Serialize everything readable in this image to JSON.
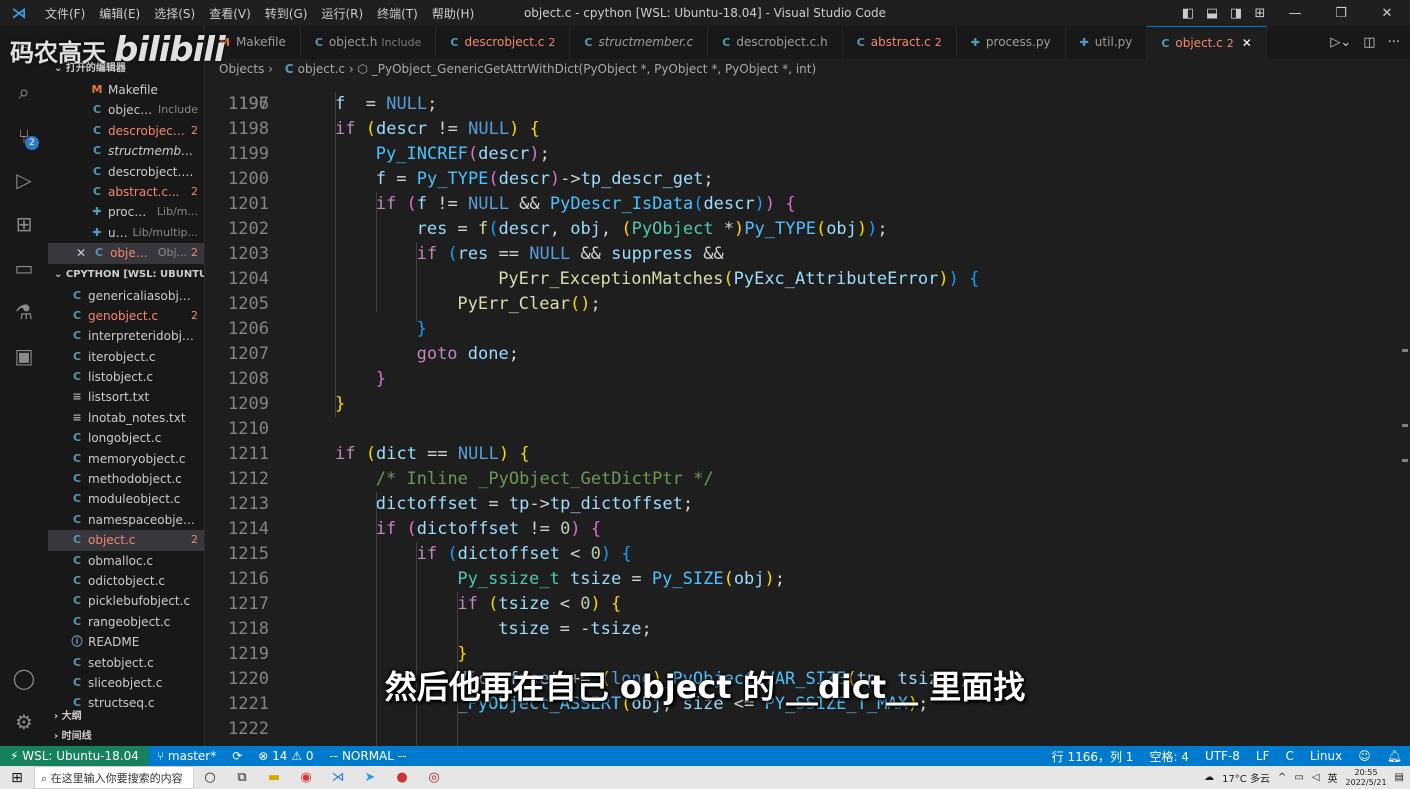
{
  "titlebar": {
    "menus": [
      "文件(F)",
      "编辑(E)",
      "选择(S)",
      "查看(V)",
      "转到(G)",
      "运行(R)",
      "终端(T)",
      "帮助(H)"
    ],
    "window_title": "object.c - cpython [WSL: Ubuntu-18.04] - Visual Studio Code"
  },
  "watermark": {
    "text": "码农高天",
    "brand": "bilibili"
  },
  "activity": {
    "scm_badge": "2"
  },
  "sidebar": {
    "open_editors_header": "打开的编辑器",
    "open_editors": [
      {
        "icon": "M",
        "name": "Makefile",
        "hint": "",
        "badge": "",
        "kind": "m"
      },
      {
        "icon": "C",
        "name": "object.h",
        "hint": "Include",
        "badge": "",
        "kind": "c"
      },
      {
        "icon": "C",
        "name": "descrobject....",
        "hint": "",
        "badge": "2",
        "kind": "c",
        "error": true
      },
      {
        "icon": "C",
        "name": "structmember.c...",
        "hint": "",
        "badge": "",
        "kind": "c",
        "italic": true
      },
      {
        "icon": "C",
        "name": "descrobject.c.h...",
        "hint": "",
        "badge": "",
        "kind": "c"
      },
      {
        "icon": "C",
        "name": "abstract.c...",
        "hint": "",
        "badge": "2",
        "kind": "c",
        "error": true
      },
      {
        "icon": "✚",
        "name": "process.py",
        "hint": "Lib/m...",
        "badge": "",
        "kind": "py"
      },
      {
        "icon": "✚",
        "name": "util.py",
        "hint": "Lib/multip...",
        "badge": "",
        "kind": "py"
      },
      {
        "icon": "C",
        "name": "object.c",
        "hint": "Obj...",
        "badge": "2",
        "kind": "c",
        "error": true,
        "active": true
      }
    ],
    "workspace_header": "CPYTHON [WSL: UBUNTU-...",
    "files": [
      {
        "icon": "C",
        "name": "genericaliasobject.c",
        "kind": "c",
        "badge": ""
      },
      {
        "icon": "C",
        "name": "genobject.c",
        "kind": "c",
        "badge": "2",
        "error": true
      },
      {
        "icon": "C",
        "name": "interpreteridobject.c",
        "kind": "c",
        "badge": ""
      },
      {
        "icon": "C",
        "name": "iterobject.c",
        "kind": "c",
        "badge": ""
      },
      {
        "icon": "C",
        "name": "listobject.c",
        "kind": "c",
        "badge": ""
      },
      {
        "icon": "≡",
        "name": "listsort.txt",
        "kind": "txt",
        "badge": ""
      },
      {
        "icon": "≡",
        "name": "lnotab_notes.txt",
        "kind": "txt",
        "badge": ""
      },
      {
        "icon": "C",
        "name": "longobject.c",
        "kind": "c",
        "badge": ""
      },
      {
        "icon": "C",
        "name": "memoryobject.c",
        "kind": "c",
        "badge": ""
      },
      {
        "icon": "C",
        "name": "methodobject.c",
        "kind": "c",
        "badge": ""
      },
      {
        "icon": "C",
        "name": "moduleobject.c",
        "kind": "c",
        "badge": ""
      },
      {
        "icon": "C",
        "name": "namespaceobject.c",
        "kind": "c",
        "badge": ""
      },
      {
        "icon": "C",
        "name": "object.c",
        "kind": "c",
        "badge": "2",
        "error": true,
        "active": true
      },
      {
        "icon": "C",
        "name": "obmalloc.c",
        "kind": "c",
        "badge": ""
      },
      {
        "icon": "C",
        "name": "odictobject.c",
        "kind": "c",
        "badge": ""
      },
      {
        "icon": "C",
        "name": "picklebufobject.c",
        "kind": "c",
        "badge": ""
      },
      {
        "icon": "C",
        "name": "rangeobject.c",
        "kind": "c",
        "badge": ""
      },
      {
        "icon": "ⓘ",
        "name": "README",
        "kind": "info",
        "badge": ""
      },
      {
        "icon": "C",
        "name": "setobject.c",
        "kind": "c",
        "badge": ""
      },
      {
        "icon": "C",
        "name": "sliceobject.c",
        "kind": "c",
        "badge": ""
      },
      {
        "icon": "C",
        "name": "structseq.c",
        "kind": "c",
        "badge": ""
      }
    ],
    "outline_label": "大纲",
    "timeline_label": "时间线"
  },
  "tabs": [
    {
      "icon": "M",
      "name": "Makefile",
      "hint": "",
      "badge": "",
      "kind": "m"
    },
    {
      "icon": "C",
      "name": "object.h",
      "hint": "Include",
      "badge": "",
      "kind": "c"
    },
    {
      "icon": "C",
      "name": "descrobject.c",
      "hint": "",
      "badge": "2",
      "kind": "c",
      "error": true
    },
    {
      "icon": "C",
      "name": "structmember.c",
      "hint": "",
      "badge": "",
      "kind": "c",
      "italic": true
    },
    {
      "icon": "C",
      "name": "descrobject.c.h",
      "hint": "",
      "badge": "",
      "kind": "c"
    },
    {
      "icon": "C",
      "name": "abstract.c",
      "hint": "",
      "badge": "2",
      "kind": "c",
      "error": true
    },
    {
      "icon": "✚",
      "name": "process.py",
      "hint": "",
      "badge": "",
      "kind": "py"
    },
    {
      "icon": "✚",
      "name": "util.py",
      "hint": "",
      "badge": "",
      "kind": "py"
    },
    {
      "icon": "C",
      "name": "object.c",
      "hint": "",
      "badge": "2",
      "kind": "c",
      "error": true,
      "active": true
    }
  ],
  "breadcrumb": {
    "folder": "Objects",
    "file": "object.c",
    "symbol": "_PyObject_GenericGetAttrWithDict(PyObject *, PyObject *, PyObject *, int)"
  },
  "editor": {
    "top_partial_line": "1196",
    "lines": [
      {
        "n": "1197",
        "indent": 2,
        "tokens": [
          [
            "vr",
            "f"
          ],
          [
            "",
            "  = "
          ],
          [
            "kw2",
            "NULL"
          ],
          [
            "",
            ";"
          ]
        ]
      },
      {
        "n": "1198",
        "indent": 2,
        "tokens": [
          [
            "kw",
            "if"
          ],
          [
            "",
            " "
          ],
          [
            "pn",
            "("
          ],
          [
            "vr",
            "descr"
          ],
          [
            "",
            " != "
          ],
          [
            "kw2",
            "NULL"
          ],
          [
            "pn",
            ")"
          ],
          [
            "",
            " "
          ],
          [
            "pn",
            "{"
          ]
        ]
      },
      {
        "n": "1199",
        "indent": 3,
        "tokens": [
          [
            "mc",
            "Py_INCREF"
          ],
          [
            "pn2",
            "("
          ],
          [
            "vr",
            "descr"
          ],
          [
            "pn2",
            ")"
          ],
          [
            "",
            ";"
          ]
        ]
      },
      {
        "n": "1200",
        "indent": 3,
        "tokens": [
          [
            "vr",
            "f"
          ],
          [
            "",
            " = "
          ],
          [
            "mc",
            "Py_TYPE"
          ],
          [
            "pn2",
            "("
          ],
          [
            "vr",
            "descr"
          ],
          [
            "pn2",
            ")"
          ],
          [
            "",
            "->"
          ],
          [
            "vr",
            "tp_descr_get"
          ],
          [
            "",
            ";"
          ]
        ]
      },
      {
        "n": "1201",
        "indent": 3,
        "tokens": [
          [
            "kw",
            "if"
          ],
          [
            "",
            " "
          ],
          [
            "pn2",
            "("
          ],
          [
            "vr",
            "f"
          ],
          [
            "",
            " != "
          ],
          [
            "kw2",
            "NULL"
          ],
          [
            "",
            " && "
          ],
          [
            "mc",
            "PyDescr_IsData"
          ],
          [
            "pn3",
            "("
          ],
          [
            "vr",
            "descr"
          ],
          [
            "pn3",
            ")"
          ],
          [
            "pn2",
            ")"
          ],
          [
            "",
            " "
          ],
          [
            "pn2",
            "{"
          ]
        ]
      },
      {
        "n": "1202",
        "indent": 4,
        "tokens": [
          [
            "vr",
            "res"
          ],
          [
            "",
            " = "
          ],
          [
            "fn",
            "f"
          ],
          [
            "pn3",
            "("
          ],
          [
            "vr",
            "descr"
          ],
          [
            "",
            ", "
          ],
          [
            "vr",
            "obj"
          ],
          [
            "",
            ", "
          ],
          [
            "pn",
            "("
          ],
          [
            "ty",
            "PyObject"
          ],
          [
            "",
            " *"
          ],
          [
            "pn",
            ")"
          ],
          [
            "mc",
            "Py_TYPE"
          ],
          [
            "pn",
            "("
          ],
          [
            "vr",
            "obj"
          ],
          [
            "pn",
            ")"
          ],
          [
            "pn3",
            ")"
          ],
          [
            "",
            ";"
          ]
        ]
      },
      {
        "n": "1203",
        "indent": 4,
        "tokens": [
          [
            "kw",
            "if"
          ],
          [
            "",
            " "
          ],
          [
            "pn3",
            "("
          ],
          [
            "vr",
            "res"
          ],
          [
            "",
            " == "
          ],
          [
            "kw2",
            "NULL"
          ],
          [
            "",
            " && "
          ],
          [
            "vr",
            "suppress"
          ],
          [
            "",
            " &&"
          ]
        ]
      },
      {
        "n": "1204",
        "indent": 6,
        "tokens": [
          [
            "fn",
            "PyErr_ExceptionMatches"
          ],
          [
            "pn",
            "("
          ],
          [
            "vr",
            "PyExc_AttributeError"
          ],
          [
            "pn",
            ")"
          ],
          [
            "pn3",
            ")"
          ],
          [
            "",
            " "
          ],
          [
            "pn3",
            "{"
          ]
        ]
      },
      {
        "n": "1205",
        "indent": 5,
        "tokens": [
          [
            "fn",
            "PyErr_Clear"
          ],
          [
            "pn",
            "()"
          ],
          [
            "",
            ";"
          ]
        ]
      },
      {
        "n": "1206",
        "indent": 4,
        "tokens": [
          [
            "pn3",
            "}"
          ]
        ]
      },
      {
        "n": "1207",
        "indent": 4,
        "tokens": [
          [
            "kw",
            "goto"
          ],
          [
            "",
            " "
          ],
          [
            "vr",
            "done"
          ],
          [
            "",
            ";"
          ]
        ]
      },
      {
        "n": "1208",
        "indent": 3,
        "tokens": [
          [
            "pn2",
            "}"
          ]
        ]
      },
      {
        "n": "1209",
        "indent": 2,
        "tokens": [
          [
            "pn",
            "}"
          ]
        ]
      },
      {
        "n": "1210",
        "indent": 0,
        "tokens": []
      },
      {
        "n": "1211",
        "indent": 2,
        "tokens": [
          [
            "kw",
            "if"
          ],
          [
            "",
            " "
          ],
          [
            "pn",
            "("
          ],
          [
            "vr",
            "dict"
          ],
          [
            "",
            " == "
          ],
          [
            "kw2",
            "NULL"
          ],
          [
            "pn",
            ")"
          ],
          [
            "",
            " "
          ],
          [
            "pn",
            "{"
          ]
        ]
      },
      {
        "n": "1212",
        "indent": 3,
        "tokens": [
          [
            "cm",
            "/* Inline _PyObject_GetDictPtr */"
          ]
        ]
      },
      {
        "n": "1213",
        "indent": 3,
        "tokens": [
          [
            "vr",
            "dictoffset"
          ],
          [
            "",
            " = "
          ],
          [
            "vr",
            "tp"
          ],
          [
            "",
            "->"
          ],
          [
            "vr",
            "tp_dictoffset"
          ],
          [
            "",
            ";"
          ]
        ]
      },
      {
        "n": "1214",
        "indent": 3,
        "tokens": [
          [
            "kw",
            "if"
          ],
          [
            "",
            " "
          ],
          [
            "pn2",
            "("
          ],
          [
            "vr",
            "dictoffset"
          ],
          [
            "",
            " != "
          ],
          [
            "nm",
            "0"
          ],
          [
            "pn2",
            ")"
          ],
          [
            "",
            " "
          ],
          [
            "pn2",
            "{"
          ]
        ]
      },
      {
        "n": "1215",
        "indent": 4,
        "tokens": [
          [
            "kw",
            "if"
          ],
          [
            "",
            " "
          ],
          [
            "pn3",
            "("
          ],
          [
            "vr",
            "dictoffset"
          ],
          [
            "",
            " < "
          ],
          [
            "nm",
            "0"
          ],
          [
            "pn3",
            ")"
          ],
          [
            "",
            " "
          ],
          [
            "pn3",
            "{"
          ]
        ]
      },
      {
        "n": "1216",
        "indent": 5,
        "tokens": [
          [
            "ty",
            "Py_ssize_t"
          ],
          [
            "",
            " "
          ],
          [
            "vr",
            "tsize"
          ],
          [
            "",
            " = "
          ],
          [
            "mc",
            "Py_SIZE"
          ],
          [
            "pn",
            "("
          ],
          [
            "vr",
            "obj"
          ],
          [
            "pn",
            ")"
          ],
          [
            "",
            ";"
          ]
        ]
      },
      {
        "n": "1217",
        "indent": 5,
        "tokens": [
          [
            "kw",
            "if"
          ],
          [
            "",
            " "
          ],
          [
            "pn",
            "("
          ],
          [
            "vr",
            "tsize"
          ],
          [
            "",
            " < "
          ],
          [
            "nm",
            "0"
          ],
          [
            "pn",
            ")"
          ],
          [
            "",
            " "
          ],
          [
            "pn",
            "{"
          ]
        ]
      },
      {
        "n": "1218",
        "indent": 6,
        "tokens": [
          [
            "vr",
            "tsize"
          ],
          [
            "",
            " = -"
          ],
          [
            "vr",
            "tsize"
          ],
          [
            "",
            ";"
          ]
        ]
      },
      {
        "n": "1219",
        "indent": 5,
        "tokens": [
          [
            "pn",
            "}"
          ]
        ]
      },
      {
        "n": "1220",
        "indent": 5,
        "tokens": [
          [
            "vr",
            "dictoffset"
          ],
          [
            "",
            " += "
          ],
          [
            "pn",
            "("
          ],
          [
            "kw2",
            "long"
          ],
          [
            "pn",
            ")"
          ],
          [
            "mc",
            "_PyObject_VAR_SIZE"
          ],
          [
            "pn",
            "("
          ],
          [
            "vr",
            "tp"
          ],
          [
            "",
            ", "
          ],
          [
            "vr",
            "tsize"
          ],
          [
            "pn",
            ")"
          ],
          [
            "",
            ";"
          ]
        ]
      },
      {
        "n": "1221",
        "indent": 5,
        "tokens": [
          [
            "mc",
            "_PyObject_ASSERT"
          ],
          [
            "pn",
            "("
          ],
          [
            "vr",
            "obj"
          ],
          [
            "",
            ", "
          ],
          [
            "vr",
            "size"
          ],
          [
            "",
            " <= "
          ],
          [
            "mc",
            "PY_SSIZE_T_MAX"
          ],
          [
            "pn",
            ")"
          ],
          [
            "",
            ";"
          ]
        ]
      },
      {
        "n": "1222",
        "indent": 0,
        "tokens": []
      }
    ]
  },
  "subtitle": "然后他再在自己 object 的 __dict__ 里面找",
  "statusbar": {
    "remote": "WSL: Ubuntu-18.04",
    "branch": "master*",
    "sync": "⟳",
    "problems": "⊗ 14 ⚠ 0",
    "mode": "-- NORMAL --",
    "position": "行 1166，列 1",
    "spaces": "空格: 4",
    "encoding": "UTF-8",
    "eol": "LF",
    "language": "C",
    "os": "Linux"
  },
  "taskbar": {
    "search_placeholder": "在这里输入你要搜索的内容",
    "weather": "17°C 多云",
    "ime": "英",
    "time": "20:55",
    "date": "2022/5/21"
  }
}
